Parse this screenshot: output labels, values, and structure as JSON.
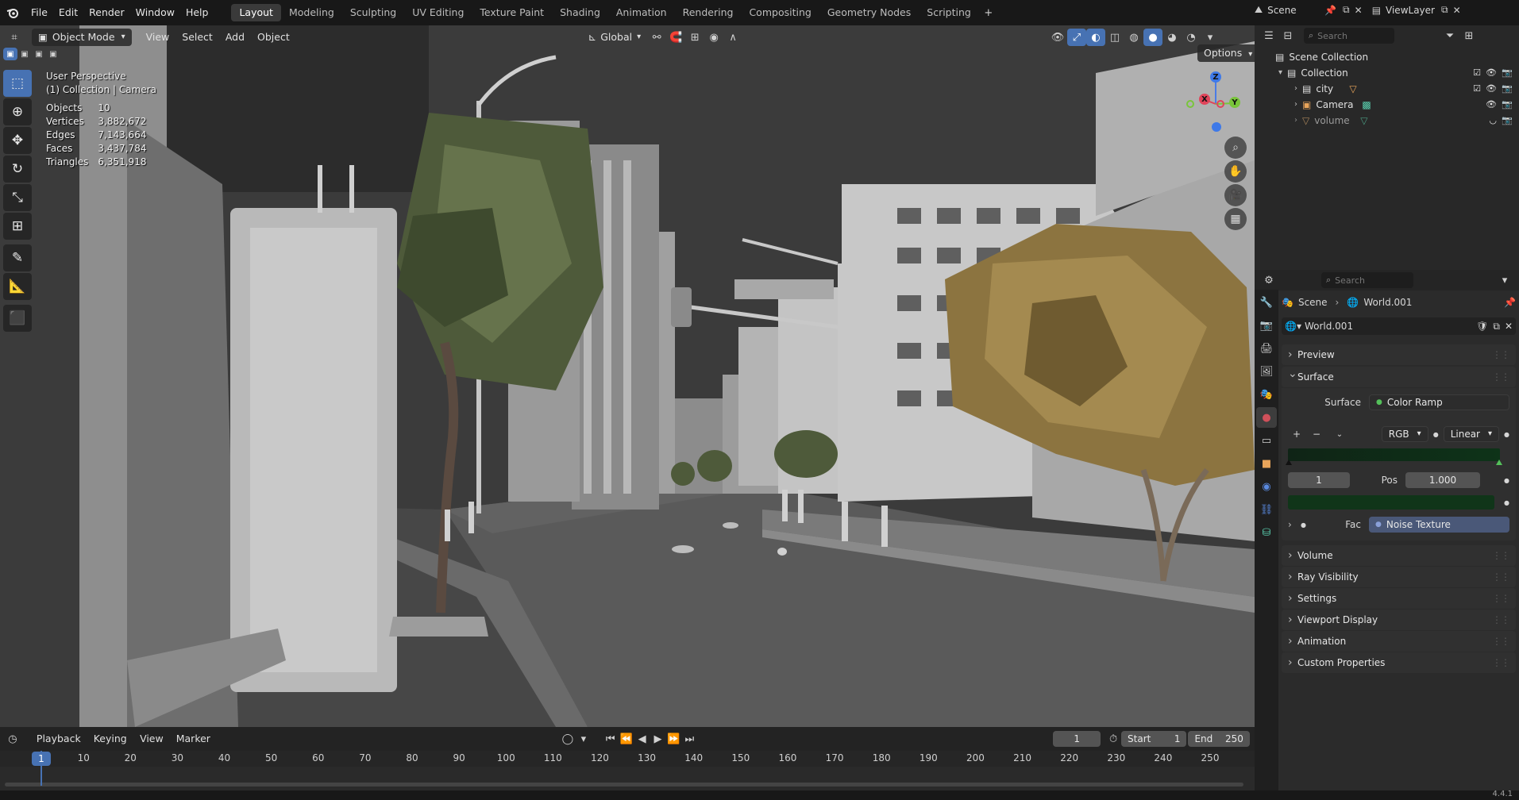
{
  "app": {
    "version": "4.4.1",
    "logo_icon": "blender-logo-icon"
  },
  "menu": {
    "file": "File",
    "edit": "Edit",
    "render": "Render",
    "window": "Window",
    "help": "Help"
  },
  "workspaces": [
    "Layout",
    "Modeling",
    "Sculpting",
    "UV Editing",
    "Texture Paint",
    "Shading",
    "Animation",
    "Rendering",
    "Compositing",
    "Geometry Nodes",
    "Scripting"
  ],
  "active_workspace": "Layout",
  "scene": {
    "label": "Scene",
    "view_layer": "ViewLayer"
  },
  "viewport": {
    "mode": "Object Mode",
    "menus": {
      "view": "View",
      "select": "Select",
      "add": "Add",
      "object": "Object"
    },
    "orientation": "Global",
    "options": "Options",
    "perspective": "User Perspective",
    "context": "(1) Collection | Camera",
    "stats": [
      {
        "label": "Objects",
        "value": "10"
      },
      {
        "label": "Vertices",
        "value": "3,882,672"
      },
      {
        "label": "Edges",
        "value": "7,143,664"
      },
      {
        "label": "Faces",
        "value": "3,437,784"
      },
      {
        "label": "Triangles",
        "value": "6,351,918"
      }
    ],
    "gizmo": {
      "x": "X",
      "y": "Y",
      "z": "Z"
    }
  },
  "outliner": {
    "search_placeholder": "Search",
    "scene_collection": "Scene Collection",
    "collection": "Collection",
    "items": [
      {
        "name": "city",
        "icon": "mesh-icon"
      },
      {
        "name": "Camera",
        "icon": "camera-icon"
      },
      {
        "name": "volume",
        "icon": "mesh-icon"
      }
    ]
  },
  "properties": {
    "search_placeholder": "Search",
    "breadcrumb": {
      "scene": "Scene",
      "world": "World.001"
    },
    "world_name": "World.001",
    "panels": {
      "preview": "Preview",
      "surface": "Surface",
      "volume": "Volume",
      "ray_visibility": "Ray Visibility",
      "settings": "Settings",
      "viewport_display": "Viewport Display",
      "animation": "Animation",
      "custom_properties": "Custom Properties"
    },
    "surface": {
      "label": "Surface",
      "value": "Color Ramp",
      "color_mode": "RGB",
      "interpolation": "Linear",
      "stop_index": "1",
      "pos_label": "Pos",
      "pos_value": "1.000",
      "fac_label": "Fac",
      "fac_value": "Noise Texture"
    },
    "colors": {
      "ramp_left": "#0f2416",
      "ramp_right": "#0e3318",
      "swatch": "#103519"
    }
  },
  "timeline": {
    "menus": {
      "playback": "Playback",
      "keying": "Keying",
      "view": "View",
      "marker": "Marker"
    },
    "current_frame": "1",
    "start_label": "Start",
    "start": "1",
    "end_label": "End",
    "end": "250",
    "playhead": "1",
    "ticks": [
      "10",
      "20",
      "30",
      "40",
      "50",
      "60",
      "70",
      "80",
      "90",
      "100",
      "110",
      "120",
      "130",
      "140",
      "150",
      "160",
      "170",
      "180",
      "190",
      "200",
      "210",
      "220",
      "230",
      "240",
      "250"
    ]
  }
}
